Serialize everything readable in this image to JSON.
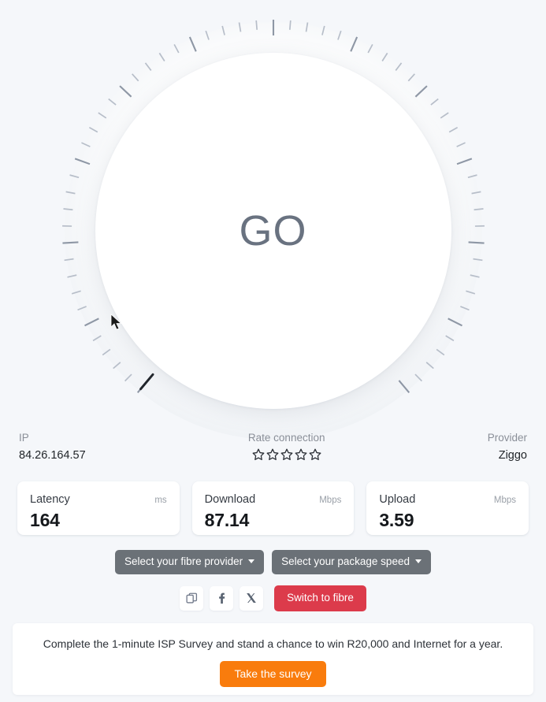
{
  "gauge": {
    "go_label": "GO",
    "tick_count": 60,
    "major_every": 5,
    "arc_start_deg": -140,
    "arc_sweep_deg": 280,
    "tick_color": "#b7bec9",
    "major_tick_color": "#8e97a5",
    "needle_position_index": 0,
    "needle_color": "#21252b",
    "go_text_color": "#697280",
    "dial_color": "#ffffff",
    "background_color": "#f5f7fa"
  },
  "info": {
    "ip_label": "IP",
    "ip_value": "84.26.164.57",
    "rate_label": "Rate connection",
    "rating_stars_total": 5,
    "rating_stars_filled": 0,
    "provider_label": "Provider",
    "provider_value": "Ziggo"
  },
  "metrics": [
    {
      "name": "Latency",
      "unit": "ms",
      "value": "164"
    },
    {
      "name": "Download",
      "unit": "Mbps",
      "value": "87.14"
    },
    {
      "name": "Upload",
      "unit": "Mbps",
      "value": "3.59"
    }
  ],
  "selects": [
    {
      "label": "Select your fibre provider",
      "icon": "chevron-down-icon"
    },
    {
      "label": "Select your package speed",
      "icon": "chevron-down-icon"
    }
  ],
  "share": {
    "copy_icon": "copy-icon",
    "facebook_icon": "facebook-icon",
    "x_icon": "x-twitter-icon",
    "switch_label": "Switch to fibre",
    "switch_color": "#dc3b4b"
  },
  "survey": {
    "text": "Complete the 1-minute ISP Survey and stand a chance to win R20,000 and Internet for a year.",
    "button_label": "Take the survey",
    "button_color": "#f97c0d"
  }
}
